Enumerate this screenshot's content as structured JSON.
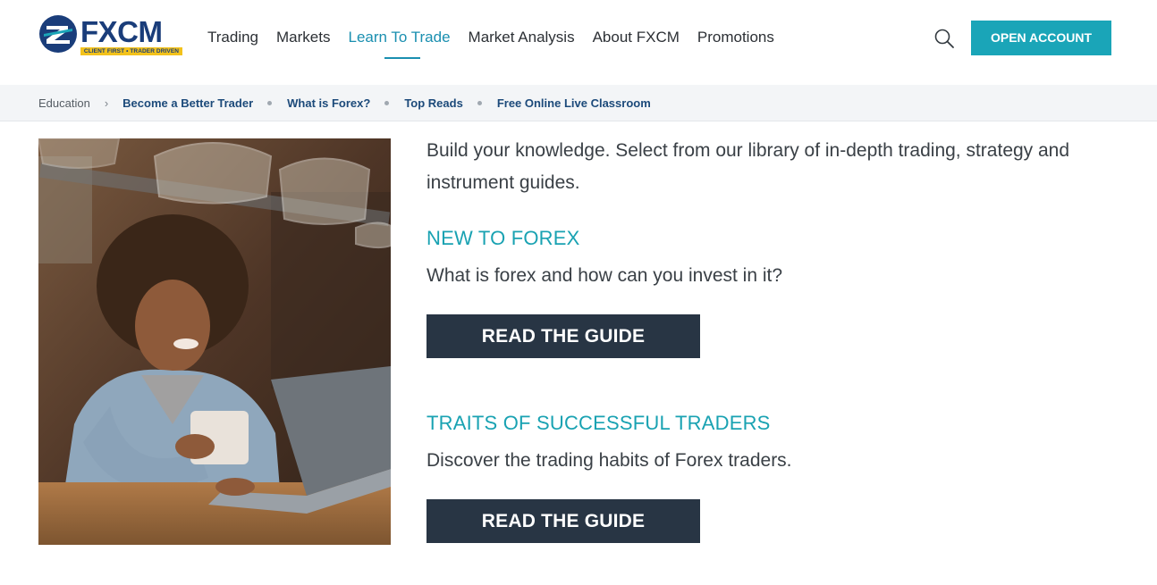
{
  "header": {
    "logo_word_fx": "FX",
    "logo_word_cm": "CM",
    "logo_tagline": "CLIENT FIRST • TRADER DRIVEN",
    "nav": [
      "Trading",
      "Markets",
      "Learn To Trade",
      "Market Analysis",
      "About FXCM",
      "Promotions"
    ],
    "active_nav": "Learn To Trade",
    "open_account_label": "OPEN ACCOUNT",
    "search_icon": "search-icon",
    "accent_color": "#1aa5b8"
  },
  "breadcrumb": {
    "root": "Education",
    "links": [
      "Become a Better Trader",
      "What is Forex?",
      "Top Reads",
      "Free Online Live Classroom"
    ]
  },
  "main": {
    "intro": "Build your knowledge. Select from our library of in-depth trading, strategy and instrument guides.",
    "sections": [
      {
        "title": "NEW TO FOREX",
        "description": "What is forex and how can you invest in it?",
        "button_label": "READ THE GUIDE"
      },
      {
        "title": "TRAITS OF SUCCESSFUL TRADERS",
        "description": "Discover the trading habits of Forex traders.",
        "button_label": "READ THE GUIDE"
      }
    ]
  }
}
